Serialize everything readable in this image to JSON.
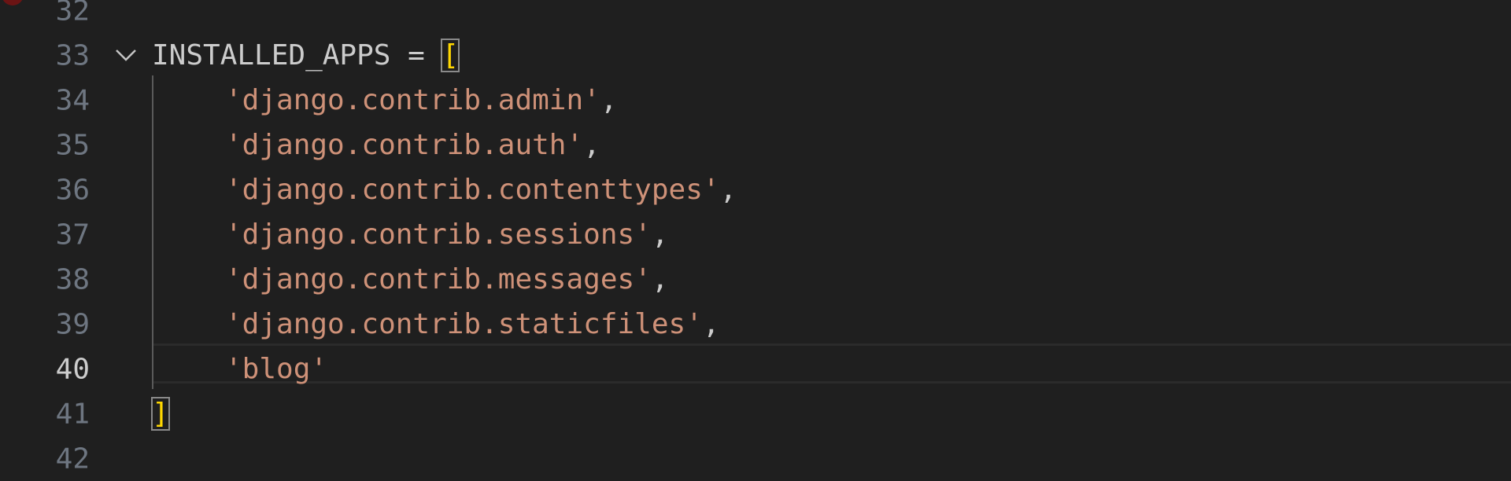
{
  "editor": {
    "active_line": "40",
    "lines": [
      {
        "number": "32",
        "segments": []
      },
      {
        "number": "33",
        "segments": [
          {
            "t": "INSTALLED_APPS",
            "k": "id"
          },
          {
            "t": " = ",
            "k": "op"
          },
          {
            "t": "[",
            "k": "bracket"
          }
        ]
      },
      {
        "number": "34",
        "segments": [
          {
            "t": "'django.contrib.admin'",
            "k": "str"
          },
          {
            "t": ",",
            "k": "punc"
          }
        ]
      },
      {
        "number": "35",
        "segments": [
          {
            "t": "'django.contrib.auth'",
            "k": "str"
          },
          {
            "t": ",",
            "k": "punc"
          }
        ]
      },
      {
        "number": "36",
        "segments": [
          {
            "t": "'django.contrib.contenttypes'",
            "k": "str"
          },
          {
            "t": ",",
            "k": "punc"
          }
        ]
      },
      {
        "number": "37",
        "segments": [
          {
            "t": "'django.contrib.sessions'",
            "k": "str"
          },
          {
            "t": ",",
            "k": "punc"
          }
        ]
      },
      {
        "number": "38",
        "segments": [
          {
            "t": "'django.contrib.messages'",
            "k": "str"
          },
          {
            "t": ",",
            "k": "punc"
          }
        ]
      },
      {
        "number": "39",
        "segments": [
          {
            "t": "'django.contrib.staticfiles'",
            "k": "str"
          },
          {
            "t": ",",
            "k": "punc"
          }
        ]
      },
      {
        "number": "40",
        "segments": [
          {
            "t": "'blog'",
            "k": "str"
          }
        ]
      },
      {
        "number": "41",
        "segments": [
          {
            "t": "]",
            "k": "bracket"
          }
        ]
      },
      {
        "number": "42",
        "segments": []
      }
    ]
  },
  "icons": {
    "fold": "chevron-down-icon",
    "breakpoint": "breakpoint-icon"
  },
  "colors": {
    "background": "#1f1f1f",
    "line_number": "#6e7681",
    "line_number_active": "#cccccc",
    "identifier": "#cccccc",
    "string": "#ce9178",
    "bracket": "#ffd700",
    "breakpoint": "#6b1414"
  }
}
